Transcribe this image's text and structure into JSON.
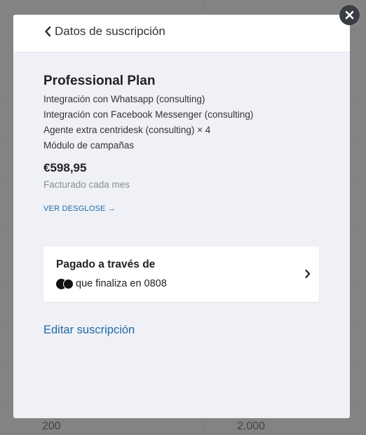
{
  "background": {
    "bottom_values": [
      "200",
      "2.000"
    ]
  },
  "modal": {
    "header_title": "Datos de suscripción",
    "plan_name": "Professional Plan",
    "features": [
      "Integración con Whatsapp (consulting)",
      "Integración con Facebook Messenger (consulting)",
      "Agente extra centridesk (consulting) × 4",
      "Módulo de campañas"
    ],
    "price": "€598,95",
    "billing_period": "Facturado cada mes",
    "breakdown_link": "VER DESGLOSE →",
    "payment": {
      "title": "Pagado a través de",
      "card_text": "que finaliza en 0808",
      "card_brand_icon": "mastercard-icon"
    },
    "edit_link": "Editar suscripción"
  },
  "colors": {
    "link": "#1f6aa5",
    "modal_bg": "#eff1f6",
    "close_bg": "#3b3d44"
  }
}
